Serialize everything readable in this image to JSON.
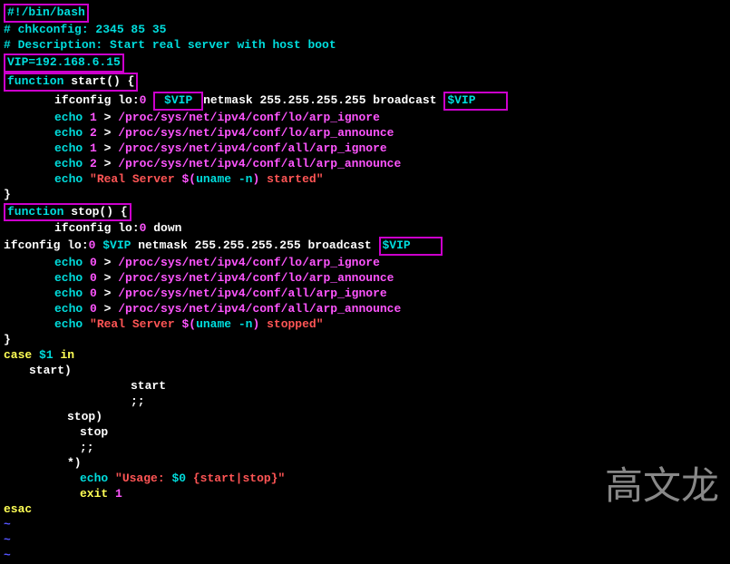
{
  "script": {
    "shebang": "#!/bin/bash",
    "comment1": "# chkconfig: 2345 85 35",
    "comment2": "# Description: Start real server with host boot",
    "vip_assign": "VIP=",
    "vip_value": "192.168.6.15",
    "func_start": "function",
    "start_name": " start() {",
    "ifconfig1_a": "ifconfig lo:",
    "ifconfig1_zero": "0",
    "ifconfig1_var": " $VIP ",
    "ifconfig1_b": "netmask 255.255.255.255 broadcast ",
    "ifconfig1_var2": "$VIP",
    "echo_kw": "echo",
    "one": " 1 ",
    "two": " 2 ",
    "zero_sp": " 0 ",
    "gt": "> ",
    "path1": "/proc/sys/net/ipv4/conf/lo/arp_ignore",
    "path2": "/proc/sys/net/ipv4/conf/lo/arp_announce",
    "path3": "/proc/sys/net/ipv4/conf/all/arp_ignore",
    "path4": "/proc/sys/net/ipv4/conf/all/arp_announce",
    "started_a": "\"Real Server ",
    "started_b": "$(",
    "started_c": "uname -n",
    "started_d": ")",
    "started_e": " started\"",
    "stopped_e": " stopped\"",
    "brace_close": "}",
    "func_stop": "function",
    "stop_name": " stop() {",
    "ifconfig2": "ifconfig lo:",
    "ifconfig2_b": " down",
    "ifconfig3_a": "ifconfig lo:",
    "ifconfig3_b": " netmask 255.255.255.255 broadcast ",
    "ifconfig3_var": "$VIP",
    "case_kw": "case",
    "case_var": " $1 ",
    "in_kw": "in",
    "start_case": "start)",
    "start_call": "start",
    "dsemi": ";;",
    "stop_case": "stop)",
    "stop_call": "stop",
    "star_case": "*)",
    "usage_a": "\"Usage: ",
    "usage_b": "$0",
    "usage_c": " {start|stop}\"",
    "exit_kw": "exit",
    "exit_val": " 1",
    "esac": "esac",
    "tilde": "~",
    "space": " "
  },
  "watermark": "高文龙"
}
